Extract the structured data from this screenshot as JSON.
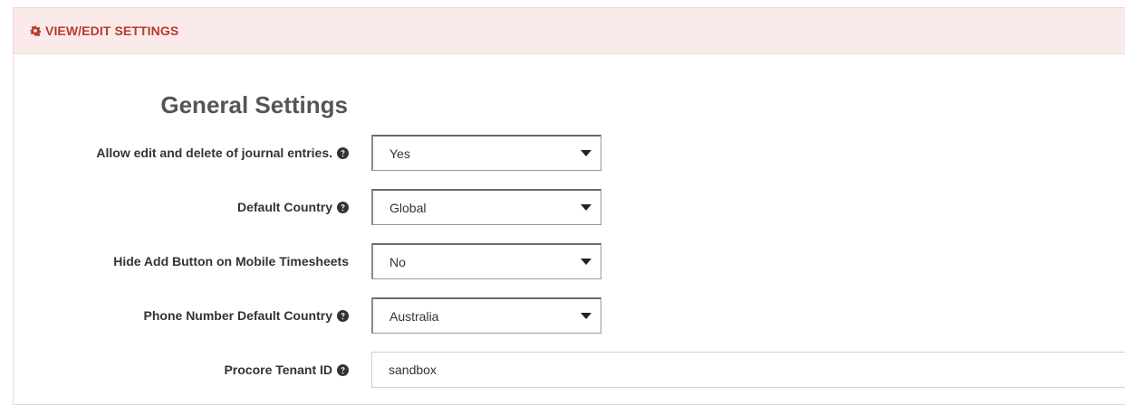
{
  "panel": {
    "heading": "VIEW/EDIT SETTINGS",
    "heading_icon": "gear-icon"
  },
  "section": {
    "title": "General Settings"
  },
  "settings": [
    {
      "label": "Allow edit and delete of journal entries.",
      "has_help": true,
      "type": "select",
      "value": "Yes"
    },
    {
      "label": "Default Country",
      "has_help": true,
      "type": "select",
      "value": "Global"
    },
    {
      "label": "Hide Add Button on Mobile Timesheets",
      "has_help": false,
      "type": "select",
      "value": "No"
    },
    {
      "label": "Phone Number Default Country",
      "has_help": true,
      "type": "select",
      "value": "Australia"
    },
    {
      "label": "Procore Tenant ID",
      "has_help": true,
      "type": "text",
      "value": "sandbox"
    }
  ],
  "colors": {
    "heading_bg": "#fbeaea",
    "heading_text": "#b83a2f",
    "label_text": "#333333"
  }
}
